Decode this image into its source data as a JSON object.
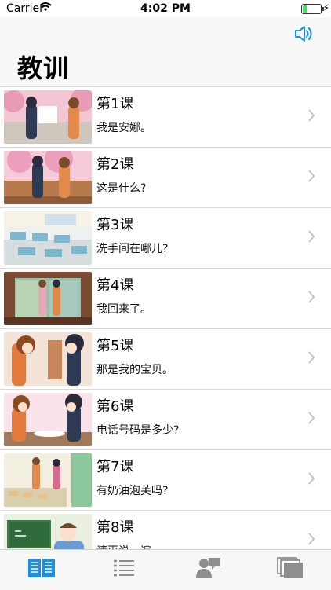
{
  "status_bar": {
    "carrier": "Carrier",
    "time": "4:02 PM",
    "battery_level": 0.28
  },
  "header": {
    "title": "教训",
    "speaker_icon": "speaker-icon"
  },
  "lessons": [
    {
      "label": "第1课",
      "sentence": "我是安娜。"
    },
    {
      "label": "第2课",
      "sentence": "这是什么?"
    },
    {
      "label": "第3课",
      "sentence": "洗手间在哪儿?"
    },
    {
      "label": "第4课",
      "sentence": "我回来了。"
    },
    {
      "label": "第5课",
      "sentence": "那是我的宝贝。"
    },
    {
      "label": "第6课",
      "sentence": "电话号码是多少?"
    },
    {
      "label": "第7课",
      "sentence": "有奶油泡芙吗?"
    },
    {
      "label": "第8课",
      "sentence": "请再说一遍。"
    }
  ],
  "tabs": [
    {
      "icon": "book-icon",
      "selected": true
    },
    {
      "icon": "list-icon",
      "selected": false
    },
    {
      "icon": "conversation-icon",
      "selected": false
    },
    {
      "icon": "cards-icon",
      "selected": false
    }
  ],
  "colors": {
    "accent": "#1a8ee8",
    "tab_inactive": "#8e8e8e"
  }
}
